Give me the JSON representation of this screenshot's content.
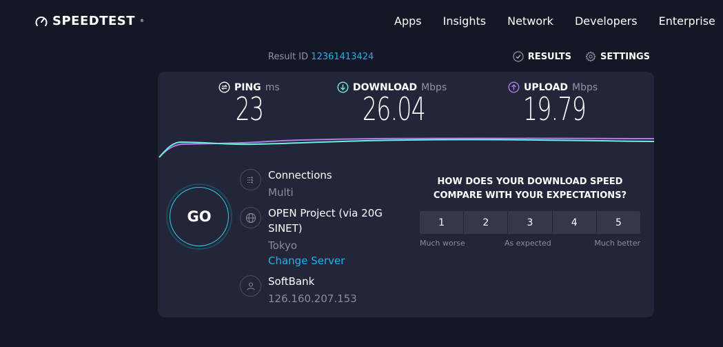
{
  "header": {
    "logo_text": "SPEEDTEST",
    "logo_icon": "gauge-icon",
    "nav": [
      "Apps",
      "Insights",
      "Network",
      "Developers",
      "Enterprise"
    ]
  },
  "result": {
    "label": "Result ID",
    "id": "12361413424",
    "actions": [
      {
        "label": "RESULTS",
        "icon": "check-circle-icon"
      },
      {
        "label": "SETTINGS",
        "icon": "gear-icon"
      }
    ]
  },
  "metrics": {
    "ping": {
      "label": "PING",
      "unit": "ms",
      "value": "23",
      "icon": "ping-icon"
    },
    "download": {
      "label": "DOWNLOAD",
      "unit": "Mbps",
      "value": "26.04",
      "icon": "download-arrow-icon",
      "color": "#6af0e0"
    },
    "upload": {
      "label": "UPLOAD",
      "unit": "Mbps",
      "value": "19.79",
      "icon": "upload-arrow-icon",
      "color": "#b07ce8"
    }
  },
  "go_button": "GO",
  "server": {
    "connections_label": "Connections",
    "connections_value": "Multi",
    "host_name": "OPEN Project (via 20G SINET)",
    "host_location": "Tokyo",
    "change_server": "Change Server",
    "isp_name": "SoftBank",
    "ip": "126.160.207.153"
  },
  "survey": {
    "question": "HOW DOES YOUR DOWNLOAD SPEED COMPARE WITH YOUR EXPECTATIONS?",
    "options": [
      "1",
      "2",
      "3",
      "4",
      "5"
    ],
    "labels": {
      "low": "Much worse",
      "mid": "As expected",
      "high": "Much better"
    }
  },
  "colors": {
    "background": "#141726",
    "panel": "#232639",
    "accent_blue": "#1fb4e6",
    "download_line": "#6af0e0",
    "upload_line": "#b07ce8"
  }
}
